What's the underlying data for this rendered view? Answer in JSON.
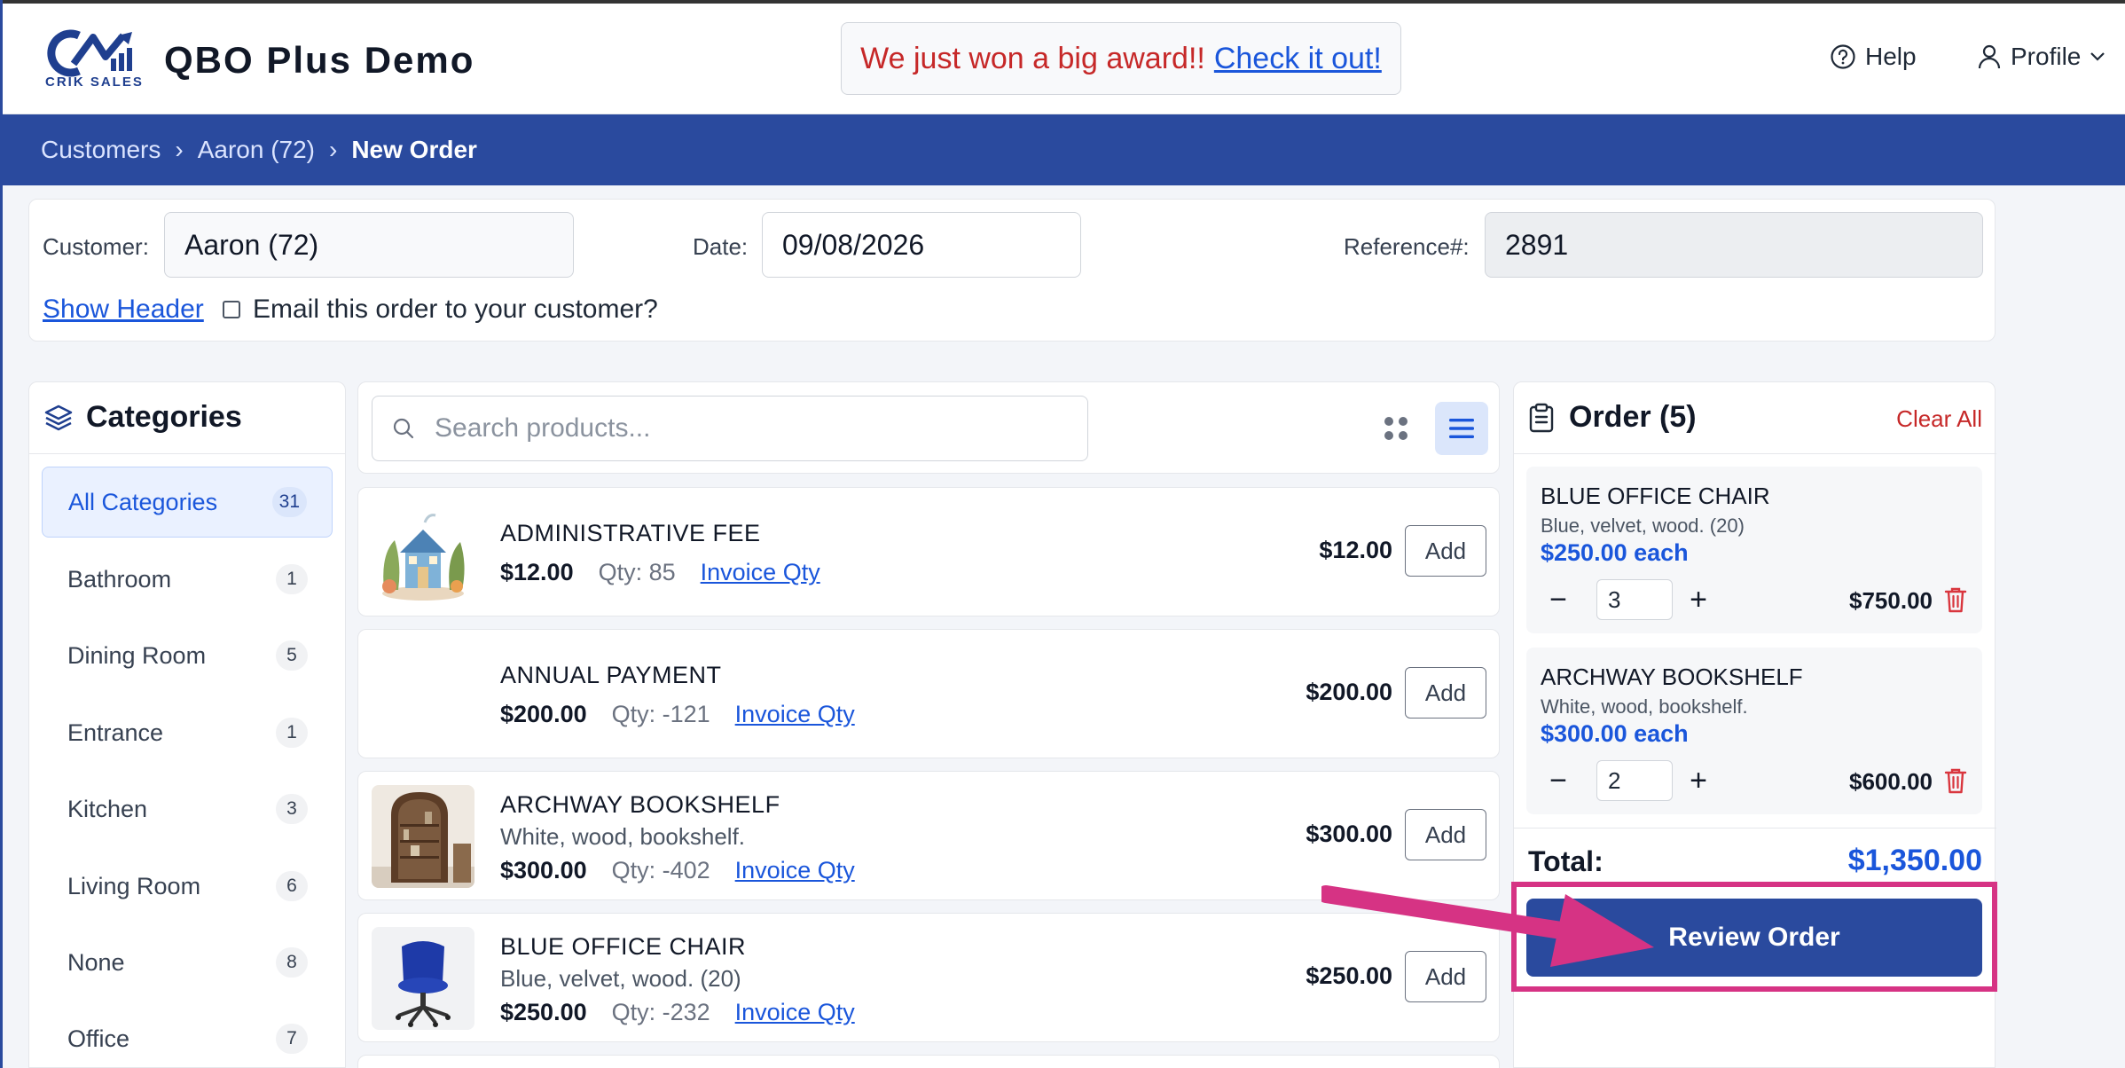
{
  "header": {
    "logo_text": "CRIK SALES",
    "app_title": "QBO Plus Demo",
    "banner": {
      "text": "We just won a big award!!",
      "link": "Check it out!"
    },
    "help_label": "Help",
    "profile_label": "Profile"
  },
  "breadcrumb": {
    "items": [
      "Customers",
      "Aaron (72)"
    ],
    "current": "New Order",
    "separator": "›"
  },
  "order_header": {
    "customer_label": "Customer:",
    "customer_value": "Aaron (72)",
    "date_label": "Date:",
    "date_value": "09/08/2026",
    "reference_label": "Reference#:",
    "reference_value": "2891",
    "show_header_link": "Show Header",
    "email_checkbox_label": "Email this order to your customer?"
  },
  "categories": {
    "title": "Categories",
    "items": [
      {
        "label": "All Categories",
        "count": "31",
        "active": true
      },
      {
        "label": "Bathroom",
        "count": "1"
      },
      {
        "label": "Dining Room",
        "count": "5"
      },
      {
        "label": "Entrance",
        "count": "1"
      },
      {
        "label": "Kitchen",
        "count": "3"
      },
      {
        "label": "Living Room",
        "count": "6"
      },
      {
        "label": "None",
        "count": "8"
      },
      {
        "label": "Office",
        "count": "7"
      }
    ]
  },
  "search": {
    "placeholder": "Search products..."
  },
  "products": [
    {
      "name": "ADMINISTRATIVE FEE",
      "desc": "",
      "price": "$12.00",
      "qty": "Qty: 85",
      "invoice": "Invoice Qty",
      "right_price": "$12.00",
      "add": "Add"
    },
    {
      "name": "ANNUAL PAYMENT",
      "desc": "",
      "price": "$200.00",
      "qty": "Qty: -121",
      "invoice": "Invoice Qty",
      "right_price": "$200.00",
      "add": "Add"
    },
    {
      "name": "ARCHWAY BOOKSHELF",
      "desc": "White, wood, bookshelf.",
      "price": "$300.00",
      "qty": "Qty: -402",
      "invoice": "Invoice Qty",
      "right_price": "$300.00",
      "add": "Add"
    },
    {
      "name": "BLUE OFFICE CHAIR",
      "desc": "Blue, velvet, wood. (20)",
      "price": "$250.00",
      "qty": "Qty: -232",
      "invoice": "Invoice Qty",
      "right_price": "$250.00",
      "add": "Add"
    }
  ],
  "order": {
    "title": "Order (5)",
    "clear_all": "Clear All",
    "items": [
      {
        "name": "BLUE OFFICE CHAIR",
        "desc": "Blue, velvet, wood. (20)",
        "each": "$250.00 each",
        "qty": "3",
        "total": "$750.00"
      },
      {
        "name": "ARCHWAY BOOKSHELF",
        "desc": "White, wood, bookshelf.",
        "each": "$300.00 each",
        "qty": "2",
        "total": "$600.00"
      }
    ],
    "total_label": "Total:",
    "total_value": "$1,350.00",
    "review_button": "Review Order"
  },
  "colors": {
    "brand_blue": "#2a4a9e",
    "link_blue": "#1a56db",
    "danger_red": "#c62828",
    "highlight_pink": "#d63384"
  }
}
